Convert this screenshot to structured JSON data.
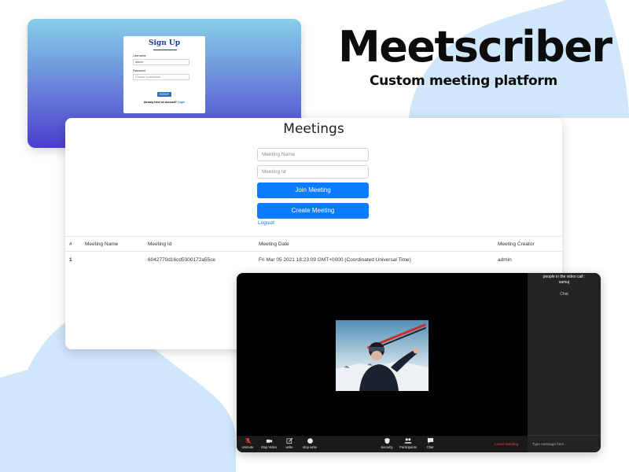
{
  "brand": {
    "title": "Meetscriber",
    "subtitle": "Custom meeting platform"
  },
  "signup": {
    "title": "Sign Up",
    "username_label": "Username",
    "username_value": "admin",
    "password_label": "Password",
    "password_placeholder": "Choose a password",
    "button_label": "SIGNUP",
    "footer_text": "Already have an account? ",
    "footer_link": "Login"
  },
  "meetings": {
    "title": "Meetings",
    "meeting_name_placeholder": "Meeting Name",
    "meeting_id_placeholder": "Meeting Id",
    "join_label": "Join Meeting",
    "create_label": "Create Meeting",
    "logout_label": "Logout!",
    "table": {
      "headers": [
        "#",
        "Meeting Name",
        "Meeting Id",
        "Meeting Date",
        "Meeting Creator"
      ],
      "rows": [
        [
          "1",
          "",
          "6042770d16cd5300172a55ce",
          "Fri Mar 05 2021 18:23:09 GMT+0000 (Coordinated Universal Time)",
          "admin"
        ]
      ]
    }
  },
  "video_call": {
    "people_label": "people in the video call :",
    "people_name": "samuj",
    "chat_label": "Chat",
    "chat_placeholder": "Type message here...",
    "toolbar": {
      "unmute": "Unmute",
      "stop_video": "Stop Video",
      "write": "write",
      "stop_write": "stop write",
      "security": "Security",
      "participants": "Participants",
      "chat": "Chat",
      "leave": "Leave Meeting"
    }
  },
  "colors": {
    "primary_button": "#0b7bff",
    "brand_text": "#0c0c0c",
    "leave_red": "#ff3b30",
    "blob_blue": "#cfe6fb"
  }
}
